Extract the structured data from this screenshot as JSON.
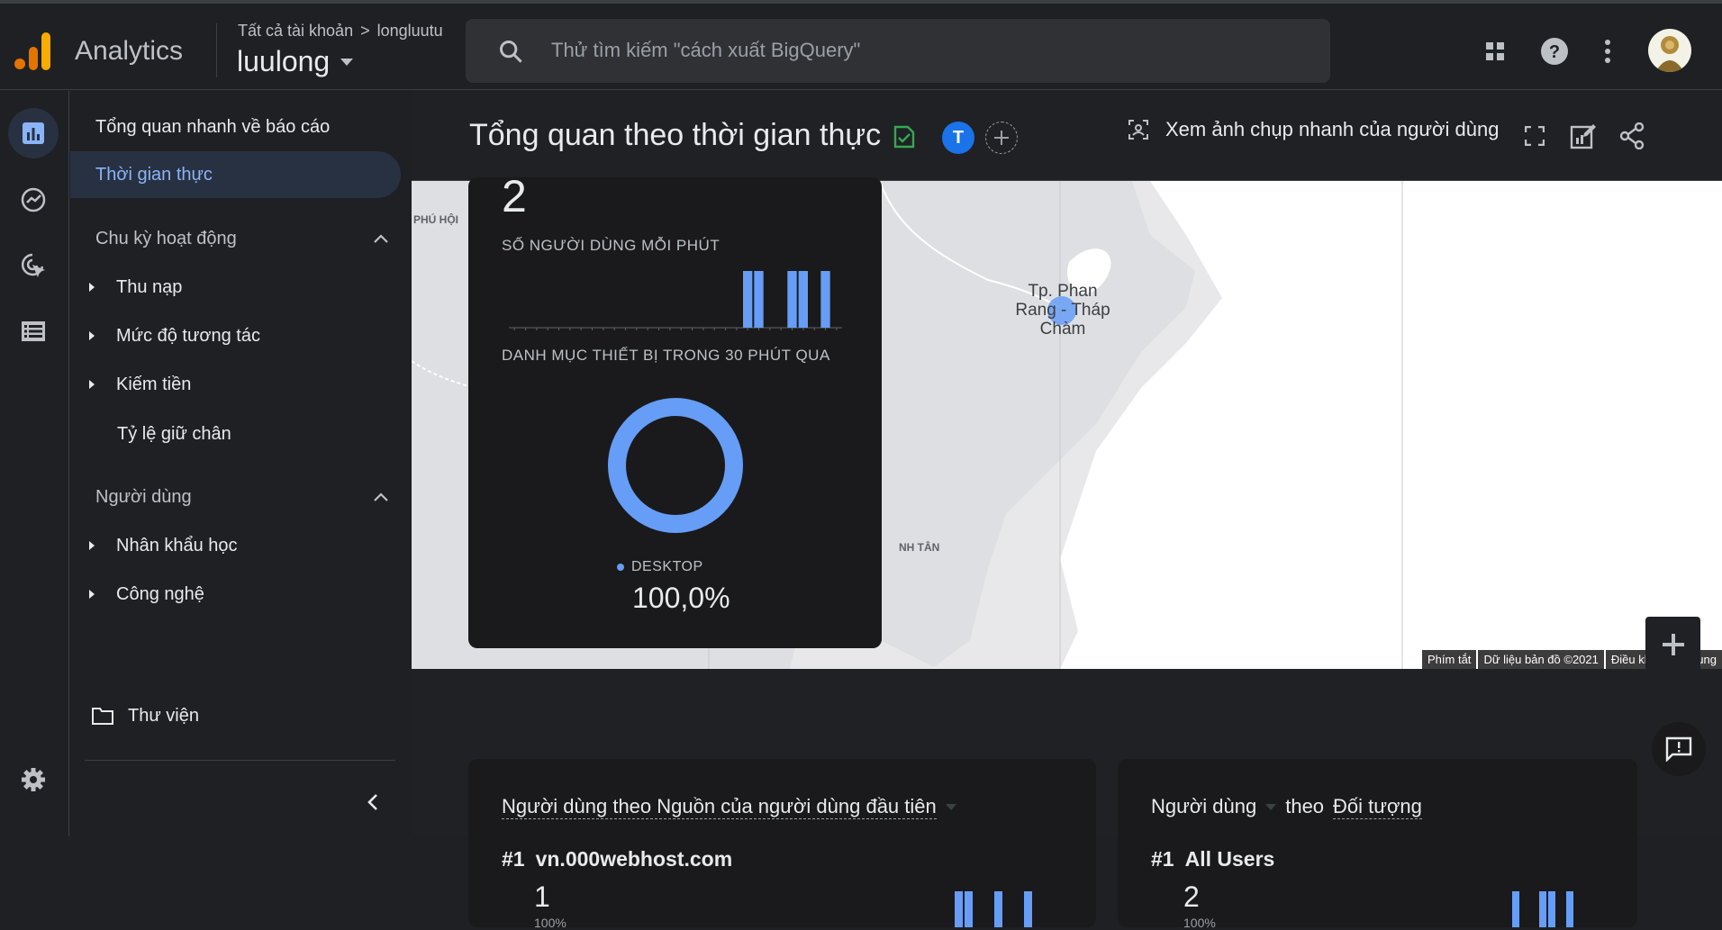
{
  "app": {
    "title": "Analytics"
  },
  "breadcrumb": {
    "all_accounts": "Tất cả tài khoản",
    "separator": ">",
    "property": "longluutu"
  },
  "account": {
    "name": "luulong"
  },
  "search": {
    "placeholder": "Thử tìm kiếm \"cách xuất BigQuery\""
  },
  "sidebar": {
    "reports_overview": "Tổng quan nhanh về báo cáo",
    "realtime": "Thời gian thực",
    "lifecycle": "Chu kỳ hoạt động",
    "lifecycle_items": [
      "Thu nạp",
      "Mức độ tương tác",
      "Kiếm tiền",
      "Tỷ lệ giữ chân"
    ],
    "user": "Người dùng",
    "user_items": [
      "Nhân khẩu học",
      "Công nghệ"
    ],
    "library": "Thư viện"
  },
  "header": {
    "title": "Tổng quan theo thời gian thực",
    "comparison_chip": "T",
    "snapshot": "Xem ảnh chụp nhanh của người dùng"
  },
  "map": {
    "city_label": "Tp. Phan Rang - Tháp Chàm",
    "label_left": "PHÚ HỘI",
    "label_bottom": "NH TÂN",
    "attribution": [
      "Phím tắt",
      "Dữ liệu bản đồ ©2021",
      "Điều khoản sử dụng"
    ]
  },
  "realtime_card": {
    "users_count": "2",
    "per_minute_label": "SỐ NGƯỜI DÙNG MỖI PHÚT",
    "device_label": "DANH MỤC THIẾT BỊ TRONG 30 PHÚT QUA",
    "legend_name": "DESKTOP",
    "legend_value": "100,0%",
    "accent": "#669df6"
  },
  "chart_data": [
    {
      "type": "bar",
      "title": "SỐ NGƯỜI DÙNG MỖI PHÚT",
      "categories": [
        "-30",
        "-29",
        "-28",
        "-27",
        "-26",
        "-25",
        "-24",
        "-23",
        "-22",
        "-21",
        "-20",
        "-19",
        "-18",
        "-17",
        "-16",
        "-15",
        "-14",
        "-13",
        "-12",
        "-11",
        "-10",
        "-9",
        "-8",
        "-7",
        "-6",
        "-5",
        "-4",
        "-3",
        "-2",
        "-1"
      ],
      "values": [
        0,
        0,
        0,
        0,
        0,
        0,
        0,
        0,
        0,
        0,
        0,
        0,
        0,
        0,
        0,
        0,
        0,
        0,
        0,
        0,
        0,
        1,
        1,
        0,
        0,
        1,
        1,
        0,
        1,
        0
      ],
      "ylim": [
        0,
        1
      ]
    },
    {
      "type": "pie",
      "title": "DANH MỤC THIẾT BỊ TRONG 30 PHÚT QUA",
      "categories": [
        "DESKTOP"
      ],
      "values": [
        100.0
      ]
    }
  ],
  "card_source": {
    "title_part1": "Người dùng theo Nguồn của người dùng đầu tiên",
    "rank": "#1",
    "top_name": "vn.000webhost.com",
    "top_value": "1",
    "top_pct": "100%"
  },
  "card_audience": {
    "title_metric": "Người dùng",
    "title_mid": "theo",
    "title_dim": "Đối tượng",
    "rank": "#1",
    "top_name": "All Users",
    "top_value": "2",
    "top_pct": "100%"
  }
}
